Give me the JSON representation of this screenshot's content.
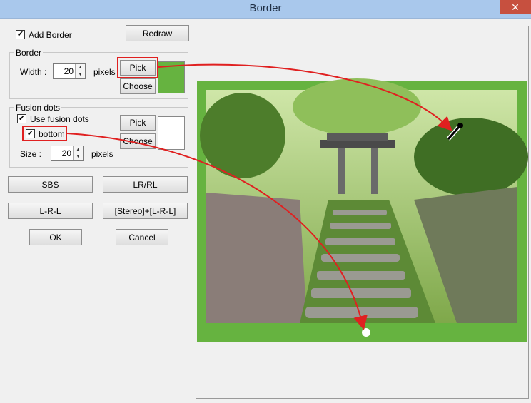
{
  "window": {
    "title": "Border",
    "close_glyph": "✕"
  },
  "add_border": {
    "label": "Add Border",
    "checked": true,
    "check_glyph": "✔"
  },
  "redraw_button": "Redraw",
  "border_group": {
    "title": "Border",
    "width_label": "Width :",
    "width_value": "20",
    "unit": "pixels",
    "pick_label": "Pick",
    "choose_label": "Choose",
    "color": "#66b340"
  },
  "fusion_group": {
    "title": "Fusion dots",
    "use_label": "Use fusion dots",
    "use_checked": true,
    "bottom_label": "bottom",
    "bottom_checked": true,
    "size_label": "Size :",
    "size_value": "20",
    "unit": "pixels",
    "pick_label": "Pick",
    "choose_label": "Choose",
    "color": "#ffffff"
  },
  "buttons": {
    "sbs": "SBS",
    "lrrl": "LR/RL",
    "lrl": "L-R-L",
    "stereo_lrl": "[Stereo]+[L-R-L]",
    "ok": "OK",
    "cancel": "Cancel"
  },
  "preview": {
    "border_color": "#66b340",
    "dot_color": "#ffffff",
    "annotation_color": "#e02020"
  },
  "icons": [
    "close-icon",
    "spin-up-icon",
    "spin-down-icon",
    "eyedropper-icon",
    "check-icon"
  ]
}
